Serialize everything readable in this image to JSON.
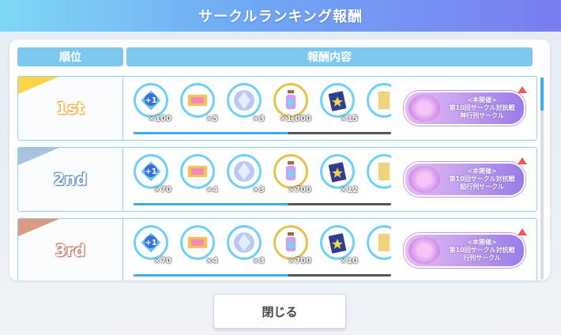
{
  "title": "サークルランキング報酬",
  "headers": {
    "rank": "順位",
    "rewards": "報酬内容"
  },
  "close_label": "閉じる",
  "rows": [
    {
      "rank": "1st",
      "rank_color": "#f4a82a",
      "tri_color": "#ffd24a",
      "scroll_fill": 0.6,
      "items": [
        {
          "icon": "plus-one-crystal-icon",
          "qty": "×100"
        },
        {
          "icon": "ticket-icon",
          "qty": "×5"
        },
        {
          "icon": "crystal-orb-icon",
          "qty": "×3"
        },
        {
          "icon": "bottle-icon",
          "qty": "×1,000"
        },
        {
          "icon": "card-pack-icon",
          "qty": "×15"
        },
        {
          "icon": "card-icon",
          "qty": ""
        }
      ],
      "banner": {
        "line1": "<本開催>",
        "line2": "第10回サークル対抗戦",
        "line3": "神行列サークル"
      }
    },
    {
      "rank": "2nd",
      "rank_color": "#5b86b8",
      "tri_color": "#a9c3dd",
      "scroll_fill": 0.6,
      "items": [
        {
          "icon": "plus-one-crystal-icon",
          "qty": "×70"
        },
        {
          "icon": "ticket-icon",
          "qty": "×4"
        },
        {
          "icon": "crystal-orb-icon",
          "qty": "×3"
        },
        {
          "icon": "bottle-icon",
          "qty": "×700"
        },
        {
          "icon": "card-pack-icon",
          "qty": "×12"
        },
        {
          "icon": "card-icon",
          "qty": ""
        }
      ],
      "banner": {
        "line1": "<本開催>",
        "line2": "第10回サークル対抗戦",
        "line3": "超行列サークル"
      }
    },
    {
      "rank": "3rd",
      "rank_color": "#c47358",
      "tri_color": "#d99a82",
      "scroll_fill": 0.6,
      "items": [
        {
          "icon": "plus-one-crystal-icon",
          "qty": "×70"
        },
        {
          "icon": "ticket-icon",
          "qty": "×4"
        },
        {
          "icon": "crystal-orb-icon",
          "qty": "×3"
        },
        {
          "icon": "bottle-icon",
          "qty": "×700"
        },
        {
          "icon": "card-pack-icon",
          "qty": "×10"
        },
        {
          "icon": "card-icon",
          "qty": ""
        }
      ],
      "banner": {
        "line1": "<本開催>",
        "line2": "第10回サークル対抗戦",
        "line3": "行列サークル"
      }
    }
  ]
}
